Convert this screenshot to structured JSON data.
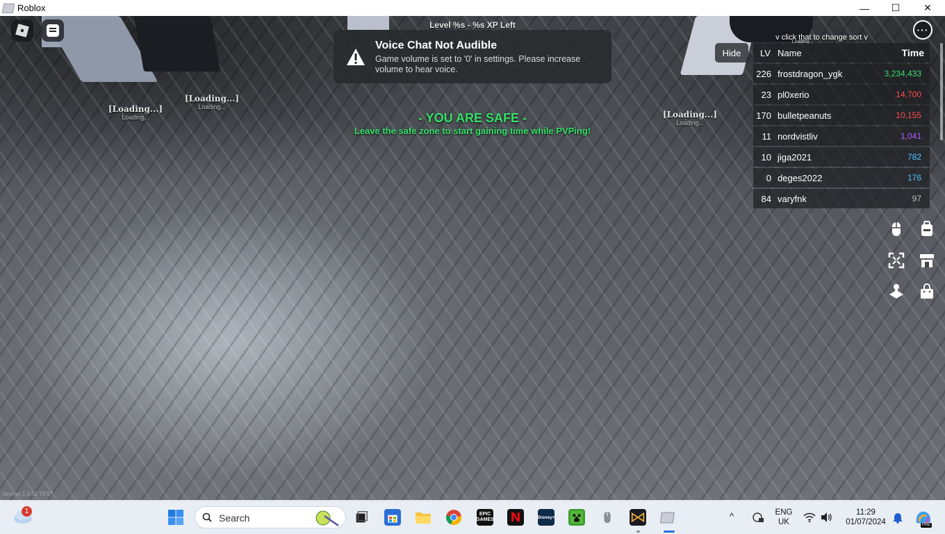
{
  "window": {
    "title": "Roblox",
    "minimize_glyph": "—",
    "maximize_glyph": "☐",
    "close_glyph": "✕"
  },
  "hud": {
    "level_text": "Level %s - %s XP Left",
    "menu_glyph": "···",
    "sort_hint": "v click that to change sort v",
    "sort_hint_sub": "Loading...",
    "version_text": "Version 1.0.01 TEST"
  },
  "toast": {
    "title": "Voice Chat Not Audible",
    "body": "Game volume is set to '0' in settings. Please increase volume to hear voice."
  },
  "nametags": [
    {
      "name": "[Loading...]",
      "sub": "Loading..."
    },
    {
      "name": "[Loading...]",
      "sub": "Loading..."
    },
    {
      "name": "[Loading...]",
      "sub": "Loading..."
    }
  ],
  "safe_zone": {
    "title": "- YOU ARE SAFE -",
    "subtitle": "Leave the safe zone to start gaining time while PVPing!",
    "color": "#36e06a"
  },
  "leaderboard": {
    "hide_label": "Hide",
    "headers": {
      "lv": "LV",
      "name": "Name",
      "time": "Time"
    },
    "rows": [
      {
        "lv": "226",
        "name": "frostdragon_ygk",
        "time": "3,234,433",
        "color": "#3ddc6a"
      },
      {
        "lv": "23",
        "name": "pl0xerio",
        "time": "14,700",
        "color": "#ff4a4a"
      },
      {
        "lv": "170",
        "name": "bulletpeanuts",
        "time": "10,155",
        "color": "#ff4a4a"
      },
      {
        "lv": "11",
        "name": "nordvistliv",
        "time": "1,041",
        "color": "#b05cff"
      },
      {
        "lv": "10",
        "name": "jiga2021",
        "time": "782",
        "color": "#4fc3ff"
      },
      {
        "lv": "0",
        "name": "deges2022",
        "time": "176",
        "color": "#4fc3ff"
      },
      {
        "lv": "84",
        "name": "varyfnk",
        "time": "97",
        "color": "#bfbfbf"
      }
    ]
  },
  "side_buttons": [
    "mouse-icon",
    "backpack-icon",
    "fullscreen-icon",
    "shop-icon",
    "emote-icon",
    "bag-icon"
  ],
  "taskbar": {
    "search_placeholder": "Search",
    "weather_badge": "1",
    "apps": [
      "start-icon",
      "task-view-icon",
      "microsoft-store-icon",
      "file-explorer-icon",
      "chrome-icon",
      "epic-games-icon",
      "netflix-icon",
      "disney-plus-icon",
      "minecraft-icon",
      "mouse-app-icon",
      "tft-icon",
      "roblox-icon"
    ],
    "epic_label": "EPIC GAMES",
    "netflix_label": "N",
    "disney_label": "Disney+",
    "lang": "ENG",
    "region": "UK",
    "time": "11:29",
    "date": "01/07/2024",
    "copilot_badge": "PRE"
  }
}
